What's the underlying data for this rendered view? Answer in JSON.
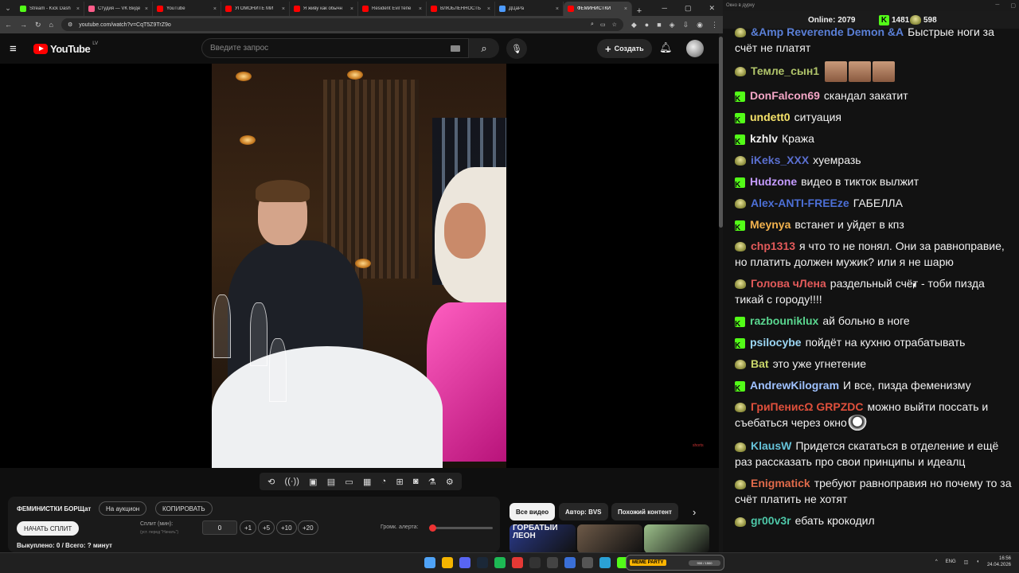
{
  "browser": {
    "tabs": [
      {
        "title": "Stream - Kick Dash",
        "color": "#53fc18"
      },
      {
        "title": "Студия — VK Виде",
        "color": "#ff5c8a"
      },
      {
        "title": "YouTube",
        "color": "#ff0000"
      },
      {
        "title": "УГОМОНИТЕ МИ",
        "color": "#ff0000"
      },
      {
        "title": "Я живу как обычн",
        "color": "#ff0000"
      },
      {
        "title": "Resident Evil тепе",
        "color": "#ff0000"
      },
      {
        "title": "ВЛЮБЛЕННОСТЬ",
        "color": "#ff0000"
      },
      {
        "title": "ДЦаРа",
        "color": "#4d9bff"
      },
      {
        "title": "ФЕМИНИСТКИ",
        "color": "#ff0000"
      }
    ],
    "url": "youtube.com/watch?v=CqT5Z9TrZ9o"
  },
  "youtube": {
    "logo_text": "YouTube",
    "country": "LV",
    "search_placeholder": "Введите запрос",
    "create_label": "Создать"
  },
  "video": {
    "watermark": "shorts"
  },
  "auction_panel": {
    "title": "ФЕМИНИСТКИ БОРЩат",
    "auction_button": "На аукцион",
    "copy_button": "КОПИРОВАТЬ",
    "split_button": "НАЧАТЬ СПЛИТ",
    "split_label": "Сплит (мин):",
    "split_hint": "(уст. перед \"Начать\")",
    "split_value": "0",
    "increments": [
      "+1",
      "+5",
      "+10",
      "+20"
    ],
    "volume_label": "Громк. алерта:",
    "volume_level": 0.03,
    "totals": "Выкуплено: 0 / Всего: ? минут"
  },
  "recommendations": {
    "chips": [
      "Все видео",
      "Автор: BVS",
      "Похожий контент"
    ],
    "thumbs": [
      {
        "label": "ГОРБАТЫЙ ЛЕОН",
        "color": "#2a3a8a"
      },
      {
        "label": "",
        "color": "#6e5a48"
      },
      {
        "label": "",
        "color": "#9cc08a"
      }
    ]
  },
  "chat": {
    "window_title": "Окно в дурку",
    "online_label": "Online:",
    "online_count": "2079",
    "kick_count": "1481",
    "yt_count": "598",
    "messages": [
      {
        "badge": "yt",
        "user": "&Amp Reverende Demon &A",
        "color": "#5a7fd6",
        "text": "Быстрые ноги за счёт не платят"
      },
      {
        "badge": "yt",
        "user": "Темле_сын1",
        "color": "#b0c46a",
        "text": "",
        "emotes": 3
      },
      {
        "badge": "kick",
        "user": "DonFalcon69",
        "color": "#f4a6c6",
        "text": "скандал закатит"
      },
      {
        "badge": "kick",
        "user": "undett0",
        "color": "#f6e36a",
        "text": "ситуация"
      },
      {
        "badge": "kick",
        "user": "kzhlv",
        "color": "#f1f1f1",
        "text": "Кража"
      },
      {
        "badge": "yt",
        "user": "iKeks_XXX",
        "color": "#5a6fd0",
        "text": "хуемразь"
      },
      {
        "badge": "kick",
        "user": "Hudzone",
        "color": "#c49bff",
        "text": "видео в тикток вылжит"
      },
      {
        "badge": "yt",
        "user": "Alex-ANTI-FREEze",
        "color": "#4c6fd6",
        "text": "ГАБЕЛЛА"
      },
      {
        "badge": "kick",
        "user": "Meynya",
        "color": "#f2b24e",
        "text": "встанет и уйдет в кпз"
      },
      {
        "badge": "yt",
        "user": "chp1313",
        "color": "#e25a5a",
        "text": "я что то не понял. Они за равноправие, но платить должен мужик? или я не шарю"
      },
      {
        "badge": "yt",
        "user": "Голова чЛена",
        "color": "#e25a5a",
        "text": "раздельный счёт - тоби пизда тикай с городу!!!!"
      },
      {
        "badge": "kick",
        "user": "razbouniklux",
        "color": "#5ad68f",
        "text": "ай больно в ноге"
      },
      {
        "badge": "kick",
        "user": "psilocybe",
        "color": "#9bd6f4",
        "text": "пойдёт на кухню отрабатывать"
      },
      {
        "badge": "yt",
        "user": "Bat",
        "color": "#c8d66a",
        "text": "это уже угнетение"
      },
      {
        "badge": "kick",
        "user": "AndrewKilogram",
        "color": "#9fc2ff",
        "text": "И все, пизда феменизму"
      },
      {
        "badge": "yt",
        "user": "ГриПенисΩ GRPZDC",
        "color": "#e0503c",
        "text": "можно выйти поссать и съебаться через окно",
        "pirate": true
      },
      {
        "badge": "yt",
        "user": "KlausW",
        "color": "#66c2d8",
        "text": "Придется скататься в отделение и ещё раз рассказать про свои принципы и идеалц"
      },
      {
        "badge": "yt",
        "user": "Enigmatick",
        "color": "#e06a4a",
        "text": "требуют равноправия но почему то за счёт платить не хотят"
      },
      {
        "badge": "yt",
        "user": "gr00v3r",
        "color": "#4ec7a8",
        "text": "ебать крокодил"
      }
    ]
  },
  "taskbar": {
    "meme_tag": "MEME PARTY",
    "meme_progress": "900 / 1500",
    "lang": "ENG",
    "time": "16:56",
    "date": "24.04.2026"
  }
}
